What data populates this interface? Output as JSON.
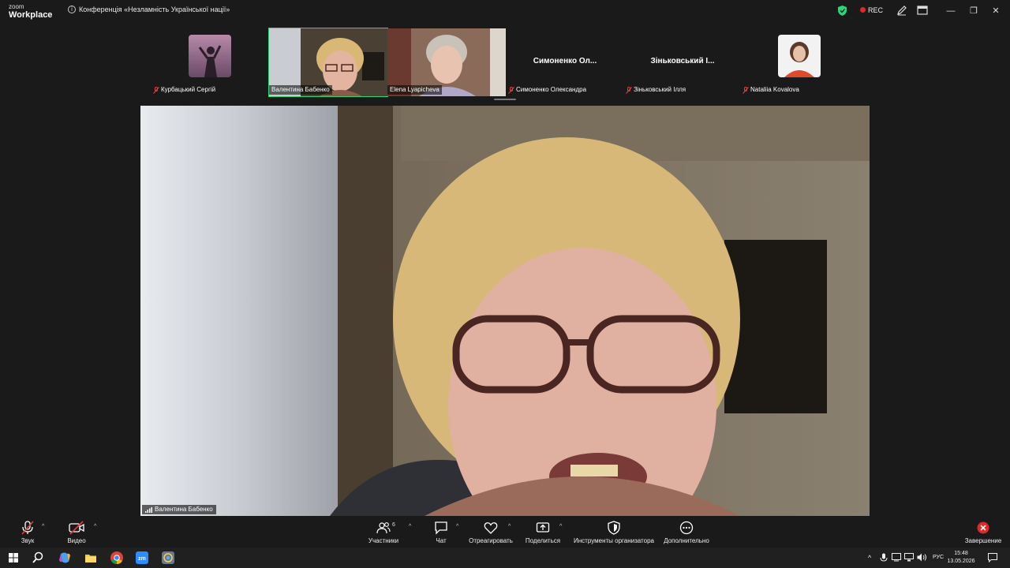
{
  "app": {
    "logo_line1": "zoom",
    "logo_line2": "Workplace",
    "meeting_title": "Конференція «Незламність Української нації»",
    "rec_label": "REC"
  },
  "participants": [
    {
      "name": "Курбацький Сергій",
      "display": "photo",
      "muted": true
    },
    {
      "name": "Валентина Бабенко",
      "display": "video",
      "muted": false,
      "active": true
    },
    {
      "name": "Elena Lyapicheva",
      "display": "video",
      "muted": true
    },
    {
      "name": "Симоненко Олександра",
      "display": "name",
      "big_name": "Симоненко  Ол...",
      "muted": true
    },
    {
      "name": "Зіньковський Ілля",
      "display": "name",
      "big_name": "Зіньковський І...",
      "muted": true
    },
    {
      "name": "Nataliia Kovalova",
      "display": "photo",
      "muted": true
    }
  ],
  "main_speaker": {
    "name": "Валентина Бабенко"
  },
  "toolbar": {
    "audio_label": "Звук",
    "video_label": "Видео",
    "participants_label": "Участники",
    "participants_count": "6",
    "chat_label": "Чат",
    "react_label": "Отреагировать",
    "share_label": "Поделиться",
    "host_tools_label": "Инструменты организатора",
    "more_label": "Дополнительно",
    "end_label": "Завершение"
  },
  "taskbar": {
    "language": "РУС",
    "time": "15:48",
    "date": "13.05.2026"
  },
  "colors": {
    "active_border": "#2ed47a",
    "muted_red": "#e04040",
    "end_red": "#e02828"
  }
}
